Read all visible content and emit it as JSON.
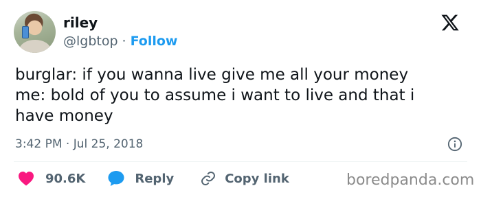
{
  "user": {
    "name": "riley",
    "handle": "@lgbtop",
    "separator": "·",
    "follow_label": "Follow",
    "avatar": "profile-photo"
  },
  "platform_logo": "x-logo-icon",
  "tweet": {
    "lines": [
      "burglar: if you wanna live give me all your money",
      "me: bold of you to assume i want to live and that i",
      "have money"
    ],
    "timestamp": "3:42 PM · Jul 25, 2018"
  },
  "actions": {
    "like_icon": "heart-icon",
    "like_count": "90.6K",
    "reply_icon": "speech-bubble-icon",
    "reply_label": "Reply",
    "copy_icon": "link-icon",
    "copy_label": "Copy link",
    "info_icon": "info-icon"
  },
  "watermark": "boredpanda.com",
  "colors": {
    "text": "#0f1419",
    "secondary": "#536471",
    "accent": "#1d9bf0",
    "like": "#f91880",
    "divider": "#eff3f4"
  }
}
